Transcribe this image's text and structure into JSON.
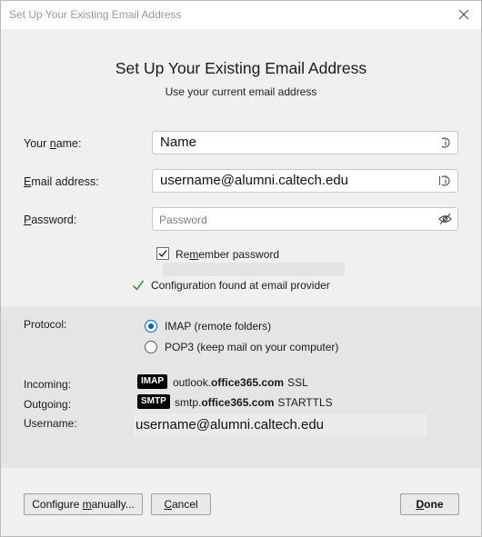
{
  "window": {
    "title": "Set Up Your Existing Email Address"
  },
  "header": {
    "title": "Set Up Your Existing Email Address",
    "subtitle": "Use your current email address"
  },
  "form": {
    "name_label_pre": "Your ",
    "name_label_key": "n",
    "name_label_post": "ame:",
    "name_value": "Name",
    "email_label_key": "E",
    "email_label_post": "mail address:",
    "email_value": "username@alumni.caltech.edu",
    "password_label_key": "P",
    "password_label_post": "assword:",
    "password_placeholder": "Password",
    "remember_key": "Re",
    "remember_key2": "m",
    "remember_post": "ember password",
    "remember_checked": true
  },
  "status": {
    "text": "Configuration found at email provider",
    "color": "#2ea043"
  },
  "protocol": {
    "label": "Protocol:",
    "options": [
      {
        "label": "IMAP (remote folders)",
        "selected": true
      },
      {
        "label": "POP3 (keep mail on your computer)",
        "selected": false
      }
    ]
  },
  "servers": {
    "incoming_label": "Incoming:",
    "incoming_badge": "IMAP",
    "incoming_host_pre": "outlook.",
    "incoming_host_bold": "office365.com",
    "incoming_security": "SSL",
    "outgoing_label": "Outgoing:",
    "outgoing_badge": "SMTP",
    "outgoing_host_pre": "smtp.",
    "outgoing_host_bold": "office365.com",
    "outgoing_security": "STARTTLS",
    "username_label": "Username:",
    "username_value": "username@alumni.caltech.edu"
  },
  "buttons": {
    "configure_pre": "Configure ",
    "configure_key": "m",
    "configure_post": "anually...",
    "cancel_key": "C",
    "cancel_post": "ancel",
    "done_key": "D",
    "done_post": "one"
  },
  "colors": {
    "accent": "#0060df"
  }
}
